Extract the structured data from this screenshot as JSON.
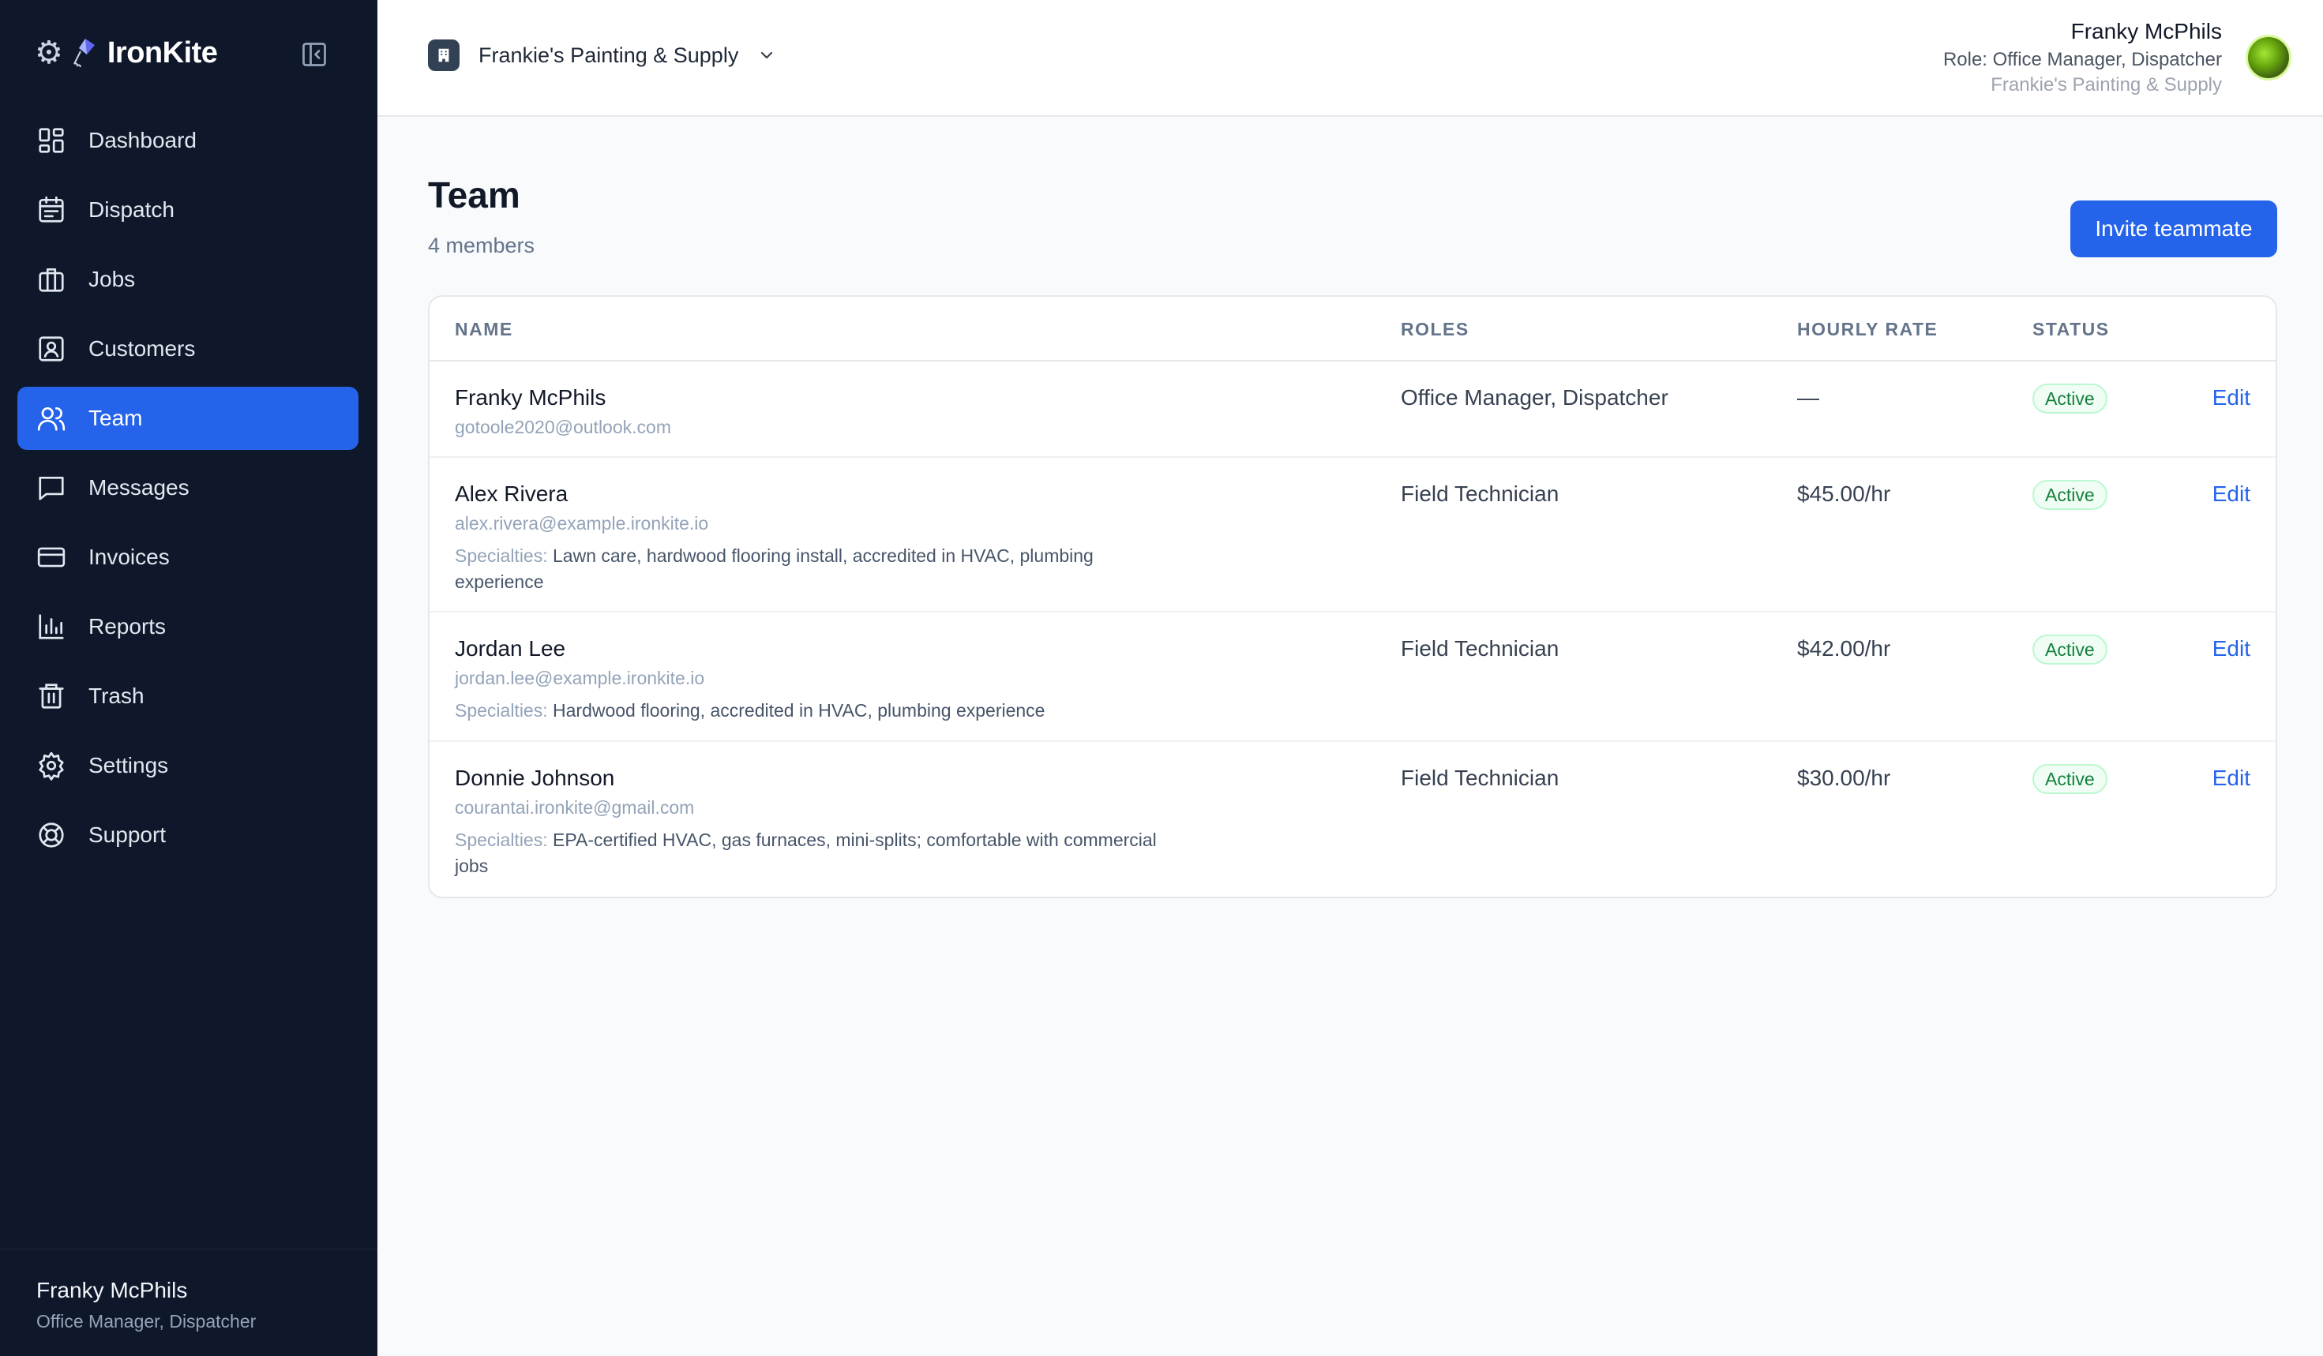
{
  "brand": {
    "name": "IronKite"
  },
  "sidebar": {
    "items": [
      {
        "label": "Dashboard",
        "icon": "dashboard-icon"
      },
      {
        "label": "Dispatch",
        "icon": "calendar-icon"
      },
      {
        "label": "Jobs",
        "icon": "briefcase-icon"
      },
      {
        "label": "Customers",
        "icon": "contact-icon"
      },
      {
        "label": "Team",
        "icon": "users-icon",
        "active": true
      },
      {
        "label": "Messages",
        "icon": "message-icon"
      },
      {
        "label": "Invoices",
        "icon": "credit-card-icon"
      },
      {
        "label": "Reports",
        "icon": "bar-chart-icon"
      },
      {
        "label": "Trash",
        "icon": "trash-icon"
      },
      {
        "label": "Settings",
        "icon": "gear-icon"
      },
      {
        "label": "Support",
        "icon": "lifebuoy-icon"
      }
    ],
    "footer": {
      "name": "Franky McPhils",
      "role": "Office Manager, Dispatcher"
    }
  },
  "topbar": {
    "org_name": "Frankie's Painting & Supply",
    "user": {
      "name": "Franky McPhils",
      "role": "Role: Office Manager, Dispatcher",
      "org": "Frankie's Painting & Supply"
    }
  },
  "page": {
    "title": "Team",
    "member_count": "4 members",
    "invite_label": "Invite teammate"
  },
  "table": {
    "headers": {
      "name": "NAME",
      "roles": "ROLES",
      "rate": "HOURLY RATE",
      "status": "STATUS"
    },
    "specialties_label": "Specialties:",
    "edit_label": "Edit",
    "rows": [
      {
        "name": "Franky McPhils",
        "email": "gotoole2020@outlook.com",
        "specialties": "",
        "roles": "Office Manager, Dispatcher",
        "rate": "—",
        "status": "Active"
      },
      {
        "name": "Alex Rivera",
        "email": "alex.rivera@example.ironkite.io",
        "specialties": "Lawn care, hardwood flooring install, accredited in HVAC, plumbing experience",
        "roles": "Field Technician",
        "rate": "$45.00/hr",
        "status": "Active"
      },
      {
        "name": "Jordan Lee",
        "email": "jordan.lee@example.ironkite.io",
        "specialties": "Hardwood flooring, accredited in HVAC, plumbing experience",
        "roles": "Field Technician",
        "rate": "$42.00/hr",
        "status": "Active"
      },
      {
        "name": "Donnie Johnson",
        "email": "courantai.ironkite@gmail.com",
        "specialties": "EPA-certified HVAC, gas furnaces, mini-splits; comfortable with commercial jobs",
        "roles": "Field Technician",
        "rate": "$30.00/hr",
        "status": "Active"
      }
    ]
  },
  "colors": {
    "sidebar_bg": "#0f172a",
    "accent": "#2563eb",
    "status_active": "#15803d"
  }
}
